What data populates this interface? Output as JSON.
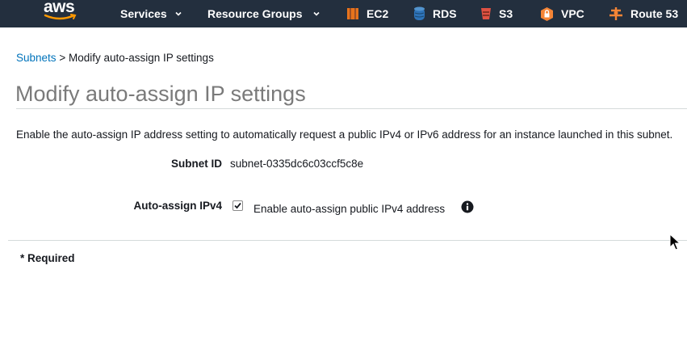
{
  "nav": {
    "logo": "aws",
    "services": "Services",
    "resource_groups": "Resource Groups",
    "shortcuts": [
      {
        "label": "EC2",
        "icon": "ec2-icon",
        "color": "#e7731c"
      },
      {
        "label": "RDS",
        "icon": "rds-icon",
        "color": "#2e73b8"
      },
      {
        "label": "S3",
        "icon": "s3-icon",
        "color": "#e05243"
      },
      {
        "label": "VPC",
        "icon": "vpc-icon",
        "color": "#f58536"
      },
      {
        "label": "Route 53",
        "icon": "route53-icon",
        "color": "#f58536"
      }
    ]
  },
  "breadcrumb": {
    "parent": "Subnets",
    "separator": ">",
    "current": "Modify auto-assign IP settings"
  },
  "page": {
    "title": "Modify auto-assign IP settings",
    "description": "Enable the auto-assign IP address setting to automatically request a public IPv4 or IPv6 address for an instance launched in this subnet."
  },
  "form": {
    "subnet_id_label": "Subnet ID",
    "subnet_id_value": "subnet-0335dc6c03ccf5c8e",
    "ipv4_label": "Auto-assign IPv4",
    "ipv4_checkbox_label": "Enable auto-assign public IPv4 address",
    "ipv4_checked": true
  },
  "footer": {
    "required_note": "* Required"
  },
  "colors": {
    "nav_bg": "#232f3e",
    "link": "#0073bb"
  }
}
